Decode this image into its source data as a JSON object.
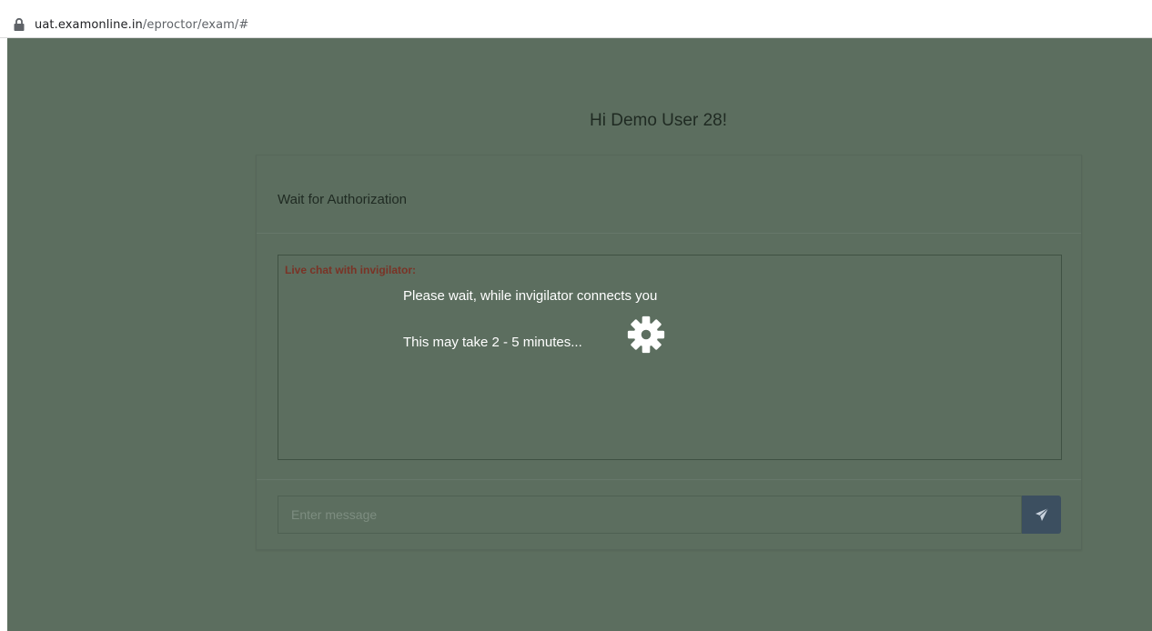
{
  "browser": {
    "url_host": "uat.examonline.in",
    "url_path": "/eproctor/exam/#"
  },
  "page": {
    "greeting": "Hi Demo User 28!",
    "panel_title": "Wait for Authorization",
    "chat": {
      "label": "Live chat with invigilator:",
      "wait_message": "Please wait, while invigilator connects you",
      "duration_message": "This may take 2 - 5 minutes..."
    },
    "message_input": {
      "placeholder": "Enter message",
      "value": ""
    }
  },
  "icons": {
    "lock": "lock-icon",
    "loading": "gear-icon",
    "send": "paper-plane-icon"
  },
  "colors": {
    "page_background": "#5c6e5f",
    "chat_label": "#7a3326",
    "send_button": "#3c4f60"
  }
}
